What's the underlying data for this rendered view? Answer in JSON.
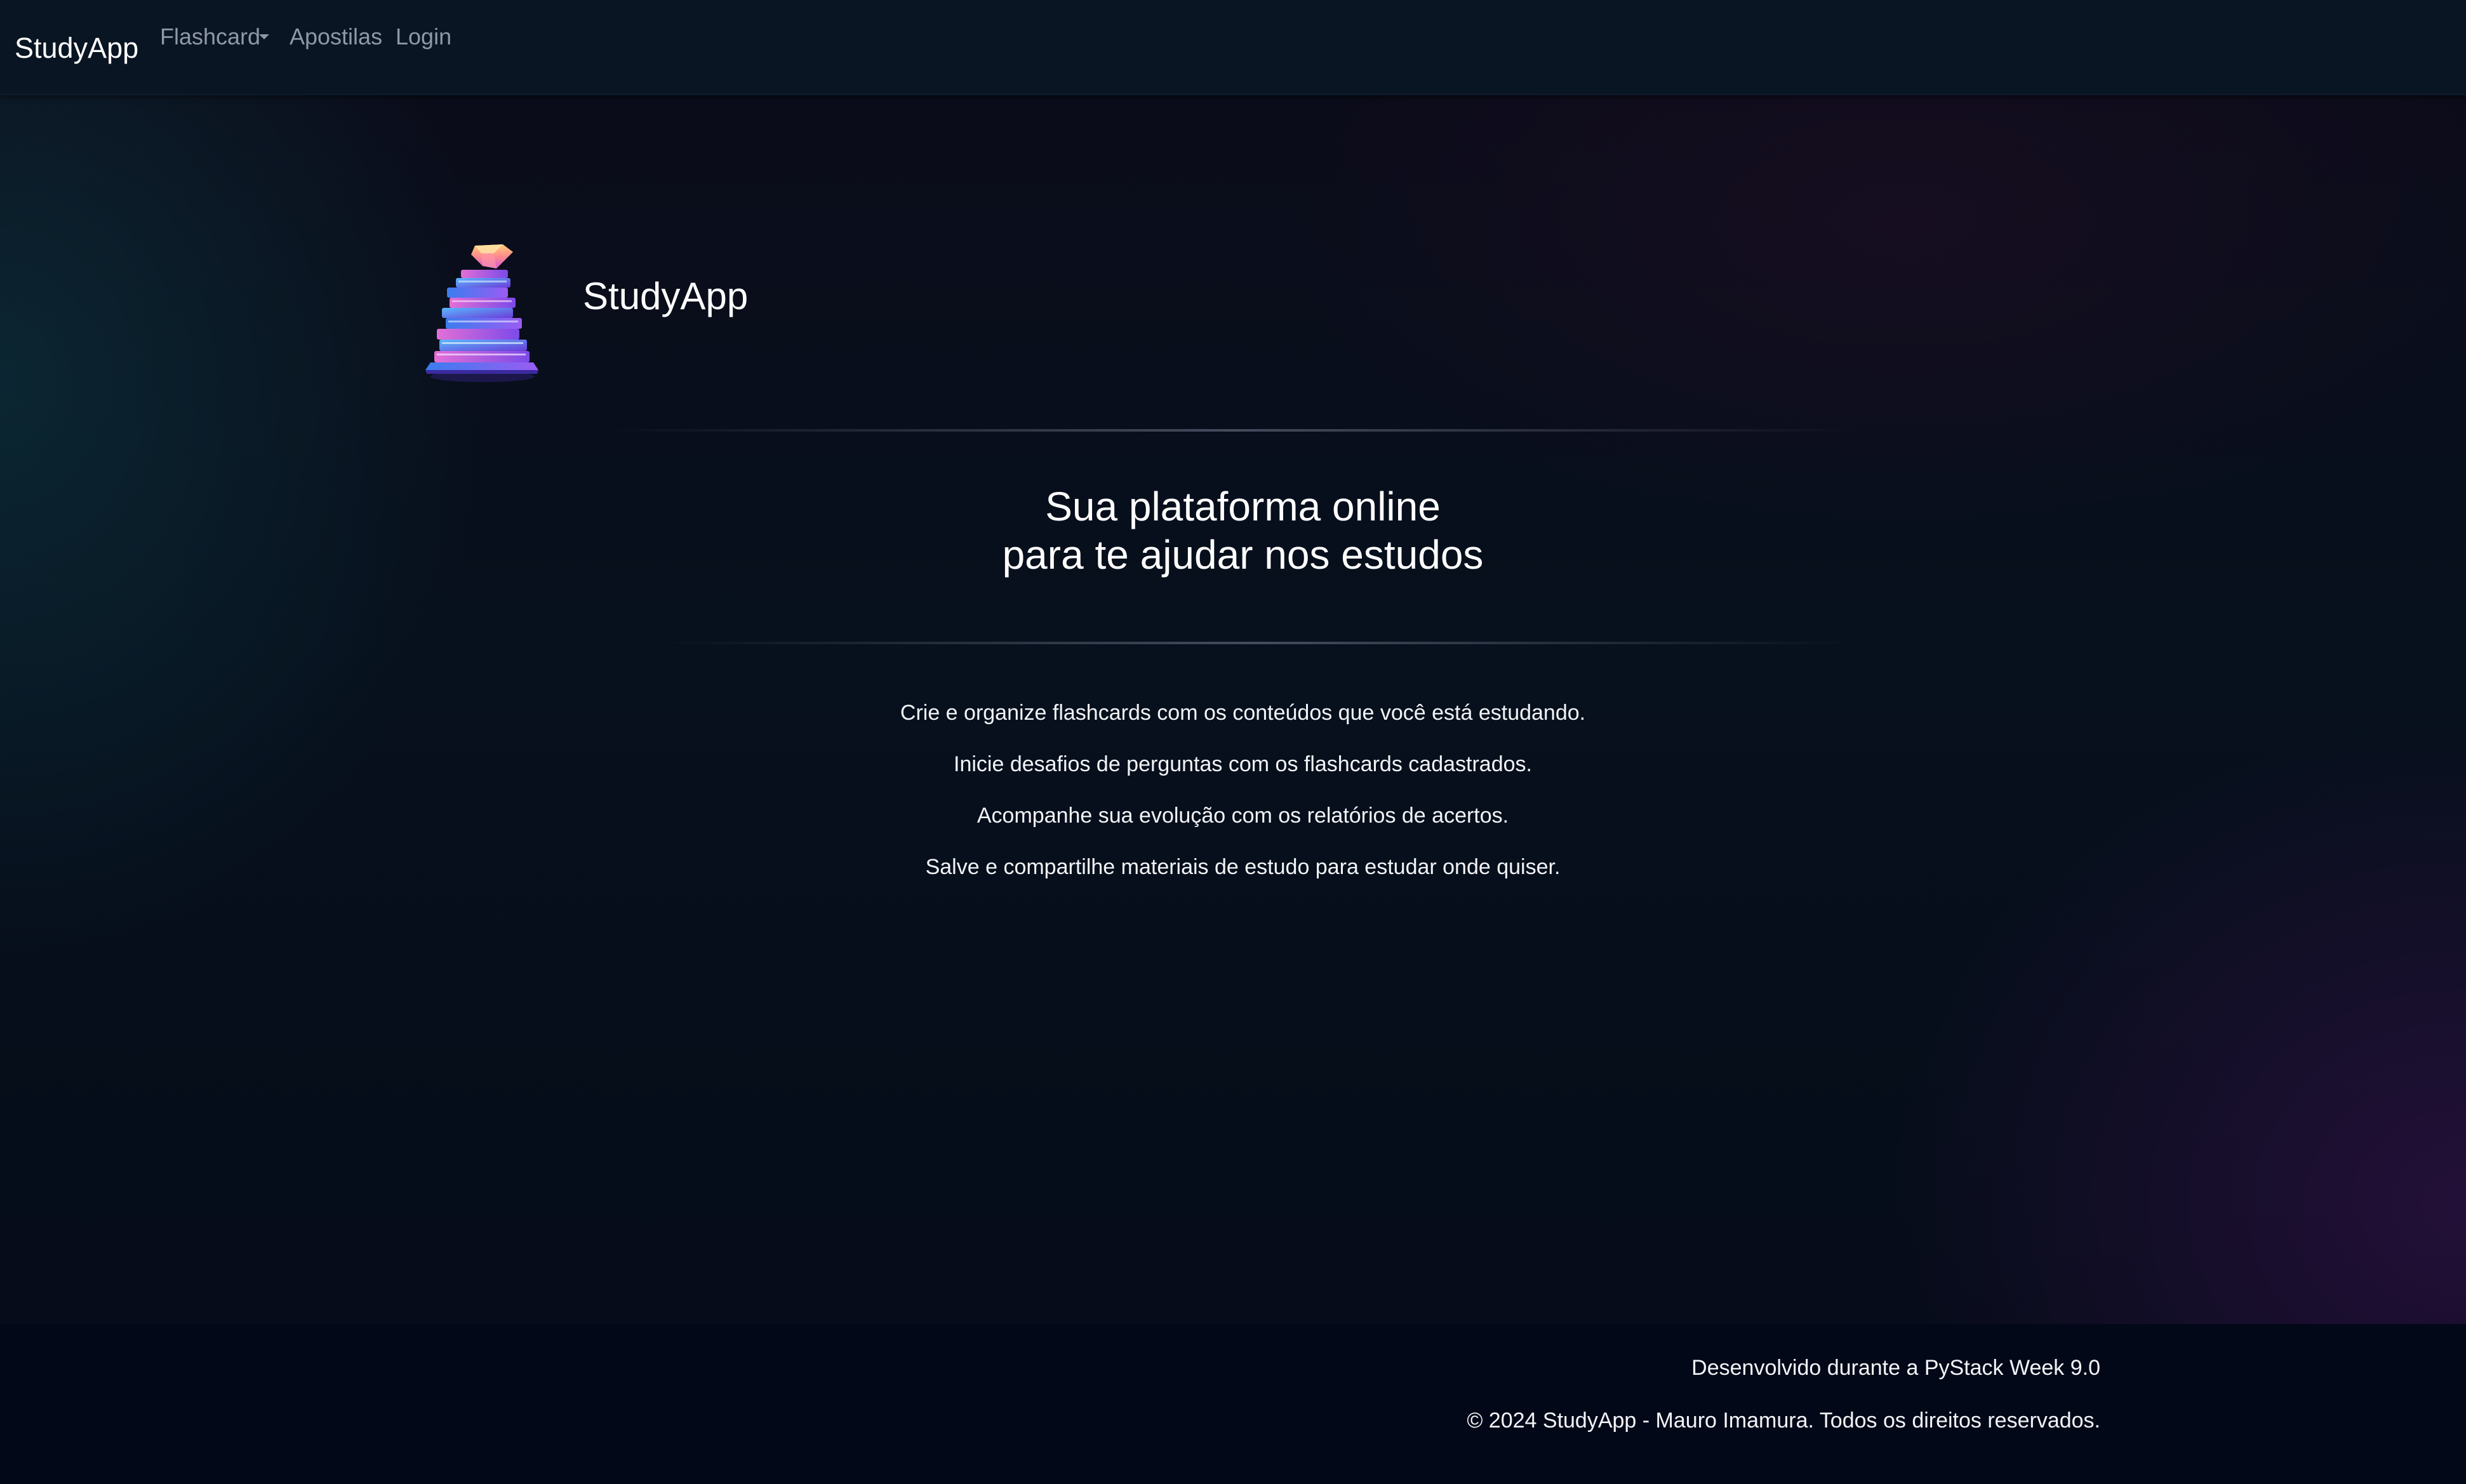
{
  "navbar": {
    "brand": "StudyApp",
    "links": {
      "flashcard": "Flashcard",
      "apostilas": "Apostilas",
      "login": "Login"
    }
  },
  "hero": {
    "logo_icon": "book-stack-logo",
    "title": "StudyApp",
    "tagline_line1": "Sua plataforma online",
    "tagline_line2": "para te ajudar nos estudos"
  },
  "features": [
    "Crie e organize flashcards com os conteúdos que você está estudando.",
    "Inicie desafios de perguntas com os flashcards cadastrados.",
    "Acompanhe sua evolução com os relatórios de acertos.",
    "Salve e compartilhe materiais de estudo para estudar onde quiser."
  ],
  "footer": {
    "line1": "Desenvolvido durante a PyStack Week 9.0",
    "line2": "© 2024 StudyApp - Mauro Imamura. Todos os direitos reservados."
  },
  "colors": {
    "navbar_bg": "#0a1523",
    "page_bg": "#07101d",
    "footer_bg": "#030818",
    "nav_link": "#8e98a7",
    "text": "#ffffff"
  }
}
